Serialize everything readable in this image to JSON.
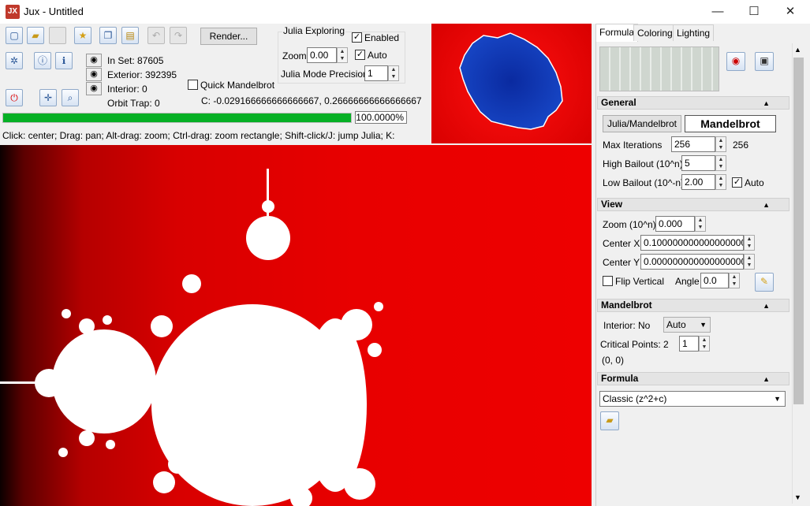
{
  "window": {
    "icon_label": "JX",
    "title": "Jux - Untitled",
    "minimize": "—",
    "maximize": "☐",
    "close": "✕"
  },
  "toolbar": {
    "render_label": "Render..."
  },
  "stats": {
    "in_set": "In Set: 87605",
    "exterior": "Exterior: 392395",
    "interior": "Interior: 0",
    "orbit_trap": "Orbit Trap: 0"
  },
  "julia": {
    "group_label": "Julia Exploring",
    "enabled_label": "Enabled",
    "enabled": true,
    "zoom_label": "Zoom",
    "zoom_value": "0.00",
    "auto_label": "Auto",
    "auto": true,
    "precision_label": "Julia Mode Precision",
    "precision_value": "1"
  },
  "quick_mandelbrot_label": "Quick Mandelbrot",
  "c_value": "C:  -0.029166666666666667, 0.26666666666666667",
  "progress": {
    "percent": 100,
    "text": "100.0000%"
  },
  "status": "Click: center; Drag: pan; Alt-drag: zoom; Ctrl-drag: zoom rectangle; Shift-click/J: jump Julia; K:",
  "tabs": [
    {
      "label": "Formula",
      "selected": true
    },
    {
      "label": "Coloring",
      "selected": false
    },
    {
      "label": "Lighting",
      "selected": false
    }
  ],
  "general": {
    "title": "General",
    "julia_mandelbrot_button": "Julia/Mandelbrot",
    "mode_display": "Mandelbrot",
    "max_iter_label": "Max Iterations",
    "max_iter_value": "256",
    "max_iter_actual": "256",
    "high_bailout_label": "High Bailout (10^n)",
    "high_bailout_value": "5",
    "low_bailout_label": "Low Bailout (10^-n)",
    "low_bailout_value": "2.00",
    "auto_label": "Auto",
    "auto": true
  },
  "view": {
    "title": "View",
    "zoom_label": "Zoom (10^n)",
    "zoom_value": "0.000",
    "center_x_label": "Center X",
    "center_x_value": "0.100000000000000000",
    "center_y_label": "Center Y",
    "center_y_value": "0.000000000000000000",
    "flip_label": "Flip Vertical",
    "flip": false,
    "angle_label": "Angle",
    "angle_value": "0.0"
  },
  "mandelbrot": {
    "title": "Mandelbrot",
    "interior_label": "Interior: No",
    "interior_select": "Auto",
    "critical_label": "Critical Points:  2",
    "critical_value": "1",
    "point": "(0, 0)"
  },
  "formula": {
    "title": "Formula",
    "select": "Classic (z^2+c)"
  }
}
